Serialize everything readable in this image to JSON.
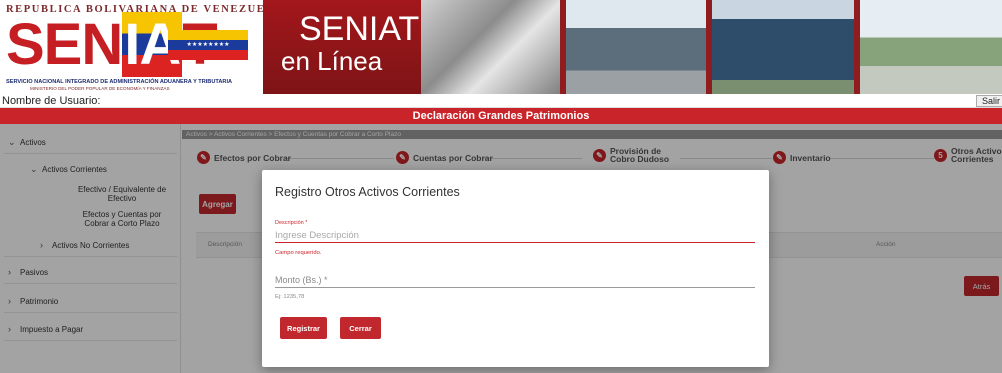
{
  "header": {
    "gov_line": "REPUBLICA BOLIVARIANA DE VENEZUELA",
    "logo_text": "SENIAT",
    "logo_left": "SEN",
    "logo_middle": "IA",
    "logo_right": "T",
    "org_line": "SERVICIO NACIONAL INTEGRADO DE ADMINISTRACIÓN ADUANERA Y TRIBUTARIA",
    "ministry_line": "MINISTERIO DEL PODER POPULAR DE ECONOMÍA Y FINANZAS",
    "online_line1": "SENIAT",
    "online_line2": "en Línea"
  },
  "userbar": {
    "label": "Nombre de Usuario:",
    "salir": "Salir"
  },
  "page_title": "Declaración Grandes Patrimonios",
  "sidebar": {
    "activos": "Activos",
    "activos_corrientes": "Activos Corrientes",
    "efectivo": "Efectivo / Equivalente de Efectivo",
    "efectos": "Efectos y Cuentas por Cobrar a Corto Plazo",
    "activos_no_corrientes": "Activos No Corrientes",
    "pasivos": "Pasivos",
    "patrimonio": "Patrimonio",
    "impuesto": "Impuesto a Pagar"
  },
  "breadcrumb": "Activos > Activos Corrientes > Efectos y Cuentas por Cobrar a Corto Plazo",
  "stepper": {
    "steps": [
      {
        "icon": "edit-icon",
        "label": "Efectos por Cobrar"
      },
      {
        "icon": "edit-icon",
        "label": "Cuentas por Cobrar"
      },
      {
        "icon": "edit-icon",
        "label": "Provisión de Cobro Dudoso"
      },
      {
        "icon": "edit-icon",
        "label": "Inventario"
      },
      {
        "number": "5",
        "label": "Otros Activos Corrientes"
      }
    ]
  },
  "main": {
    "agregar": "Agregar",
    "table_headers": [
      "Descripción",
      "Acción"
    ],
    "atras": "Atrás"
  },
  "modal": {
    "title": "Registro Otros Activos Corrientes",
    "descripcion_label": "Descripción *",
    "descripcion_placeholder": "Ingrese Descripción",
    "descripcion_error": "Campo requerido.",
    "monto_placeholder": "Monto (Bs.) *",
    "monto_hint": "Ej: 1235,78",
    "registrar": "Registrar",
    "cerrar": "Cerrar"
  },
  "colors": {
    "brand_red": "#c9242a",
    "button_red": "#c0282d",
    "banner_dark": "#8f1c1e"
  }
}
